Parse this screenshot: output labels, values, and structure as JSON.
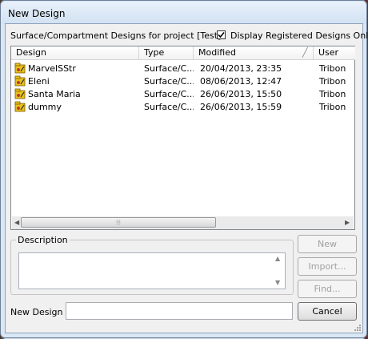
{
  "window": {
    "title": "New Design"
  },
  "header": {
    "project_label": "Surface/Compartment Designs for project [Test]",
    "filter_checkbox_label": "Display Registered Designs Only",
    "filter_checked": true
  },
  "list": {
    "columns": [
      "Design",
      "Type",
      "Modified",
      "User"
    ],
    "rows": [
      {
        "design": "MarvelSStr",
        "type": "Surface/C...",
        "modified": "20/04/2013, 23:35",
        "user": "Tribon"
      },
      {
        "design": "Eleni",
        "type": "Surface/C...",
        "modified": "08/06/2013, 12:47",
        "user": "Tribon"
      },
      {
        "design": "Santa Maria",
        "type": "Surface/C...",
        "modified": "26/06/2013, 15:50",
        "user": "Tribon"
      },
      {
        "design": "dummy",
        "type": "Surface/C...",
        "modified": "26/06/2013, 15:59",
        "user": "Tribon"
      }
    ],
    "row_icon": "design-folder-icon"
  },
  "description": {
    "label": "Description",
    "value": ""
  },
  "new_design": {
    "label": "New Design",
    "value": ""
  },
  "buttons": {
    "new": "New",
    "import": "Import...",
    "find": "Find...",
    "cancel": "Cancel"
  },
  "colors": {
    "icon_yellow": "#e8c21c",
    "icon_red": "#c0392b",
    "title_bg": "#d9e6f4"
  }
}
